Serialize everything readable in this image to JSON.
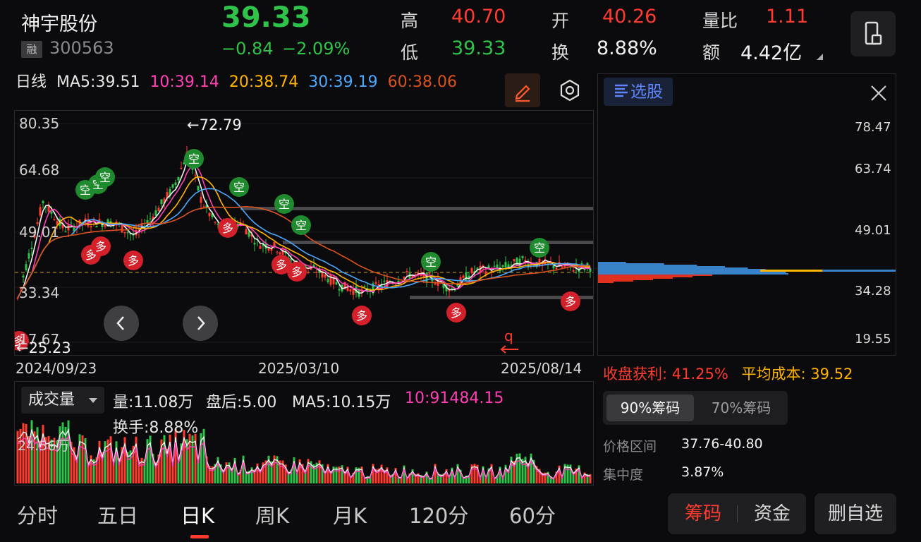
{
  "header": {
    "stock_name": "神宇股份",
    "badge": "融",
    "stock_code": "300563",
    "price": "39.33",
    "change": "−0.84",
    "change_pct": "−2.09%",
    "high_label": "高",
    "high": "40.70",
    "low_label": "低",
    "low": "39.33",
    "open_label": "开",
    "open": "40.26",
    "turnover_label": "换",
    "turnover": "8.88%",
    "vol_ratio_label": "量比",
    "vol_ratio": "1.11",
    "amount_label": "额",
    "amount": "4.42亿"
  },
  "ma_bar": {
    "period": "日线",
    "ma5": "MA5:39.51",
    "ma10": "10:39.14",
    "ma20": "20:38.74",
    "ma30": "30:39.19",
    "ma60": "60:38.06"
  },
  "colors": {
    "up": "#ff3b30",
    "down": "#2fc34a",
    "ma5": "#f2f2f2",
    "ma10": "#ff3fb4",
    "ma20": "#ffb400",
    "ma30": "#4aa8ff",
    "ma60": "#d9531e"
  },
  "kline": {
    "y_labels": [
      "80.35",
      "64.68",
      "49.01",
      "33.34",
      "17.67"
    ],
    "max_marker": "←72.79",
    "min_marker": "←25.23",
    "dates": [
      "2024/09/23",
      "2025/03/10",
      "2025/08/14"
    ],
    "signal_short": "空",
    "signal_long": "多"
  },
  "volume": {
    "selector": "成交量",
    "vol": "量:11.08万",
    "after_hours": "盘后:5.00",
    "ma5": "MA5:10.15万",
    "ma10": "10:91484.15",
    "turnover": "换手:8.88%",
    "axis_label": "24.56万"
  },
  "chips": {
    "tag": "选股",
    "price_labels": [
      "78.47",
      "63.74",
      "49.01",
      "34.28",
      "19.55"
    ],
    "profit_label": "收盘获利:",
    "profit": "41.25%",
    "avg_cost_label": "平均成本:",
    "avg_cost": "39.52",
    "tab_90": "90%筹码",
    "tab_70": "70%筹码",
    "range_label": "价格区间",
    "range": "37.76-40.80",
    "concentration_label": "集中度",
    "concentration": "3.87%"
  },
  "bottom_tabs": [
    "分时",
    "五日",
    "日K",
    "周K",
    "月K",
    "120分",
    "60分"
  ],
  "bottom_buttons": {
    "chips": "筹码",
    "funds": "资金",
    "delete": "删自选"
  }
}
